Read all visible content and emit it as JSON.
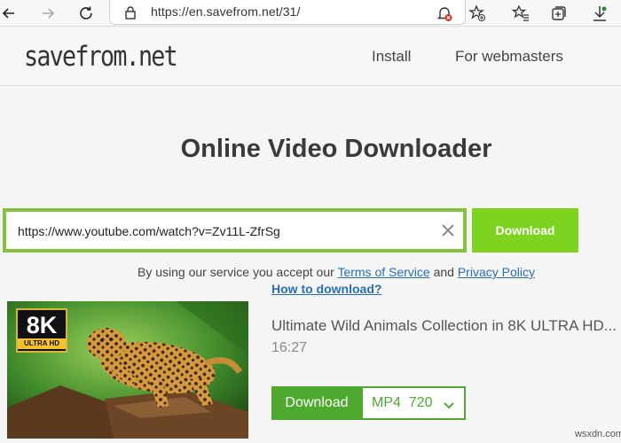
{
  "browser": {
    "url": "https://en.savefrom.net/31/",
    "icons": [
      "back-arrow-icon",
      "forward-arrow-icon",
      "refresh-icon",
      "lock-icon",
      "blocked-popup-icon",
      "add-favorite-icon",
      "favorites-icon",
      "collections-icon",
      "downloads-icon"
    ]
  },
  "header": {
    "logo": "savefrom.net",
    "nav": [
      "Install",
      "For webmasters"
    ]
  },
  "hero": {
    "title": "Online Video Downloader",
    "url_value": "https://www.youtube.com/watch?v=Zv11L-ZfrSg",
    "download_label": "Download",
    "terms_prefix": "By using our service you accept our ",
    "terms_link": "Terms of Service",
    "terms_and": " and ",
    "privacy_link": "Privacy Policy",
    "howto": "How to download?"
  },
  "result": {
    "badge_big": "8K",
    "badge_small": "ULTRA HD",
    "title": "Ultimate Wild Animals Collection in 8K ULTRA HD...",
    "duration": "16:27",
    "download_label": "Download",
    "format": "MP4  720"
  },
  "watermark": "wsxdn.com",
  "colors": {
    "accent_green": "#7ed321",
    "dark_green": "#4daa2e",
    "link_blue": "#2a6ebb",
    "border_green": "#84c43d"
  }
}
